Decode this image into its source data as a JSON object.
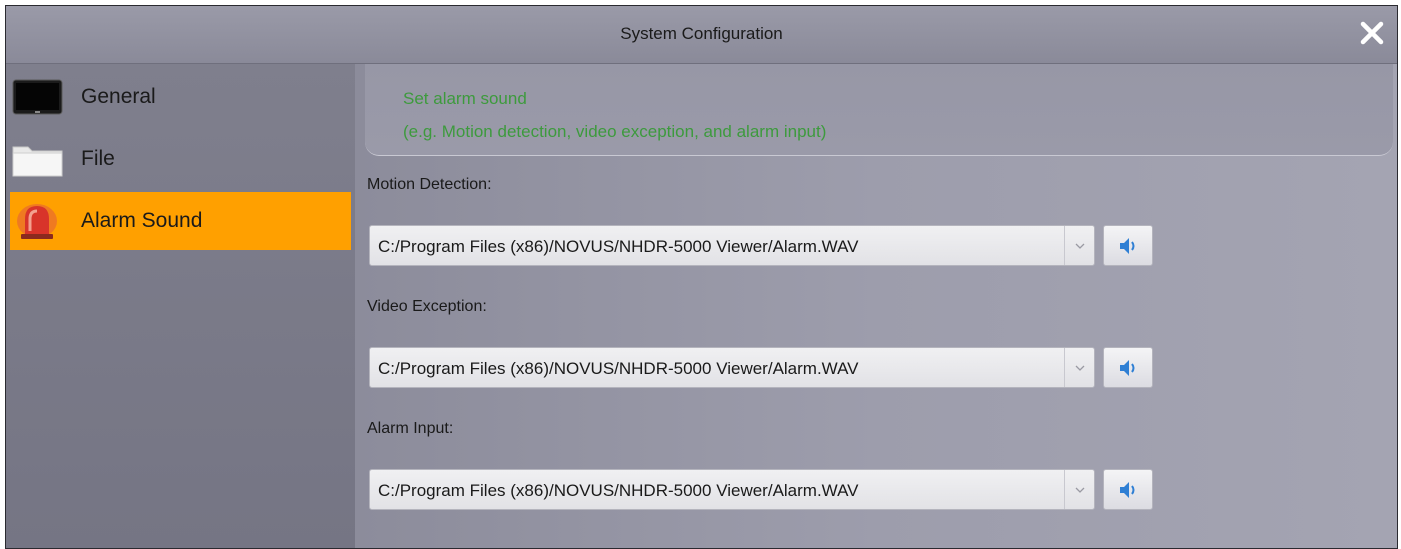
{
  "window": {
    "title": "System Configuration"
  },
  "sidebar": {
    "items": [
      {
        "label": "General",
        "icon": "monitor-icon",
        "active": false
      },
      {
        "label": "File",
        "icon": "folder-icon",
        "active": false
      },
      {
        "label": "Alarm Sound",
        "icon": "alarm-light-icon",
        "active": true
      }
    ]
  },
  "content": {
    "hint": {
      "line1": "Set alarm sound",
      "line2": "(e.g. Motion detection, video exception, and alarm input)"
    },
    "fields": [
      {
        "label": "Motion Detection:",
        "value": "C:/Program Files (x86)/NOVUS/NHDR-5000 Viewer/Alarm.WAV"
      },
      {
        "label": "Video Exception:",
        "value": "C:/Program Files (x86)/NOVUS/NHDR-5000 Viewer/Alarm.WAV"
      },
      {
        "label": "Alarm Input:",
        "value": "C:/Program Files (x86)/NOVUS/NHDR-5000 Viewer/Alarm.WAV"
      }
    ]
  },
  "colors": {
    "accent": "#ffa000",
    "hint_text": "#3d9a3d",
    "window_bg": "#8e8e9c"
  }
}
